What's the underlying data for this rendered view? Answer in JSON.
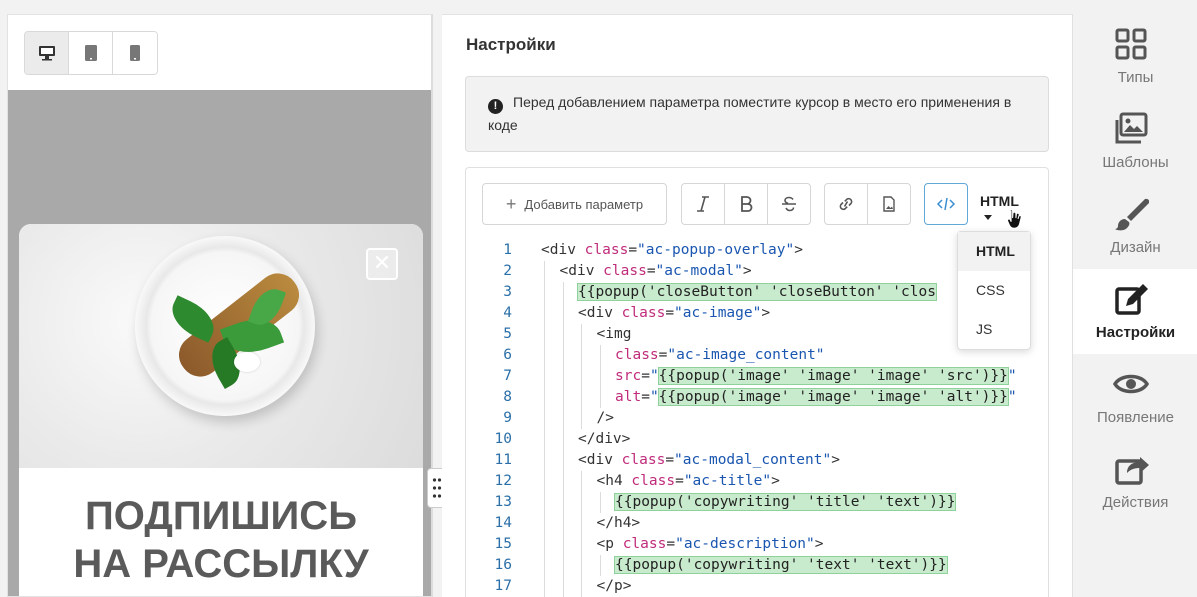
{
  "preview": {
    "devices": [
      {
        "name": "desktop-icon",
        "active": true
      },
      {
        "name": "tablet-icon",
        "active": false
      },
      {
        "name": "mobile-icon",
        "active": false
      }
    ],
    "popup_title_line1": "ПОДПИШИСЬ",
    "popup_title_line2": "НА РАССЫЛКУ",
    "close_glyph": "✕"
  },
  "settings": {
    "title": "Настройки",
    "notice": "Перед добавлением параметра поместите курсор в место его применения в коде",
    "notice_icon": "!",
    "add_param_label": "Добавить параметр",
    "language": "HTML",
    "dropdown_options": [
      "HTML",
      "CSS",
      "JS"
    ]
  },
  "code_lines": [
    {
      "n": "1",
      "indent": 0,
      "parts": [
        [
          "tag",
          "<div "
        ],
        [
          "attr",
          "class"
        ],
        [
          "tag",
          "="
        ],
        [
          "val",
          "\"ac-popup-overlay\""
        ],
        [
          "tag",
          ">"
        ]
      ]
    },
    {
      "n": "2",
      "indent": 1,
      "parts": [
        [
          "tag",
          "<div "
        ],
        [
          "attr",
          "class"
        ],
        [
          "tag",
          "="
        ],
        [
          "val",
          "\"ac-modal\""
        ],
        [
          "tag",
          ">"
        ]
      ]
    },
    {
      "n": "3",
      "indent": 2,
      "parts": [
        [
          "tpl",
          "{{popup('closeButton' 'closeButton' 'clos"
        ]
      ]
    },
    {
      "n": "4",
      "indent": 2,
      "parts": [
        [
          "tag",
          "<div "
        ],
        [
          "attr",
          "class"
        ],
        [
          "tag",
          "="
        ],
        [
          "val",
          "\"ac-image\""
        ],
        [
          "tag",
          ">"
        ]
      ]
    },
    {
      "n": "5",
      "indent": 3,
      "parts": [
        [
          "tag",
          "<img"
        ]
      ]
    },
    {
      "n": "6",
      "indent": 4,
      "parts": [
        [
          "attr",
          "class"
        ],
        [
          "tag",
          "="
        ],
        [
          "val",
          "\"ac-image_content\""
        ]
      ]
    },
    {
      "n": "7",
      "indent": 4,
      "parts": [
        [
          "attr",
          "src"
        ],
        [
          "tag",
          "="
        ],
        [
          "val",
          "\""
        ],
        [
          "tpl",
          "{{popup('image' 'image' 'image' 'src')}}"
        ],
        [
          "val",
          "\""
        ]
      ]
    },
    {
      "n": "8",
      "indent": 4,
      "parts": [
        [
          "attr",
          "alt"
        ],
        [
          "tag",
          "="
        ],
        [
          "val",
          "\""
        ],
        [
          "tpl",
          "{{popup('image' 'image' 'image' 'alt')}}"
        ],
        [
          "val",
          "\""
        ]
      ]
    },
    {
      "n": "9",
      "indent": 3,
      "parts": [
        [
          "tag",
          "/>"
        ]
      ]
    },
    {
      "n": "10",
      "indent": 2,
      "parts": [
        [
          "tag",
          "</div>"
        ]
      ]
    },
    {
      "n": "11",
      "indent": 2,
      "parts": [
        [
          "tag",
          "<div "
        ],
        [
          "attr",
          "class"
        ],
        [
          "tag",
          "="
        ],
        [
          "val",
          "\"ac-modal_content\""
        ],
        [
          "tag",
          ">"
        ]
      ]
    },
    {
      "n": "12",
      "indent": 3,
      "parts": [
        [
          "tag",
          "<h4 "
        ],
        [
          "attr",
          "class"
        ],
        [
          "tag",
          "="
        ],
        [
          "val",
          "\"ac-title\""
        ],
        [
          "tag",
          ">"
        ]
      ]
    },
    {
      "n": "13",
      "indent": 4,
      "parts": [
        [
          "tpl",
          "{{popup('copywriting' 'title' 'text')}}"
        ]
      ]
    },
    {
      "n": "14",
      "indent": 3,
      "parts": [
        [
          "tag",
          "</h4>"
        ]
      ]
    },
    {
      "n": "15",
      "indent": 3,
      "parts": [
        [
          "tag",
          "<p "
        ],
        [
          "attr",
          "class"
        ],
        [
          "tag",
          "="
        ],
        [
          "val",
          "\"ac-description\""
        ],
        [
          "tag",
          ">"
        ]
      ]
    },
    {
      "n": "16",
      "indent": 4,
      "parts": [
        [
          "tpl",
          "{{popup('copywriting' 'text' 'text')}}"
        ]
      ]
    },
    {
      "n": "17",
      "indent": 3,
      "parts": [
        [
          "tag",
          "</p>"
        ]
      ]
    }
  ],
  "nav": [
    {
      "label": "Типы",
      "icon": "grid-icon",
      "active": false
    },
    {
      "label": "Шаблоны",
      "icon": "images-icon",
      "active": false
    },
    {
      "label": "Дизайн",
      "icon": "brush-icon",
      "active": false
    },
    {
      "label": "Настройки",
      "icon": "edit-icon",
      "active": true
    },
    {
      "label": "Появление",
      "icon": "eye-icon",
      "active": false
    },
    {
      "label": "Действия",
      "icon": "share-icon",
      "active": false
    }
  ]
}
